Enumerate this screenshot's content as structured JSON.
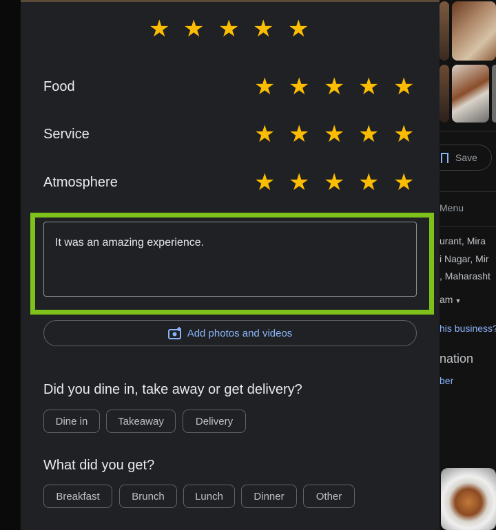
{
  "overall_rating": 5,
  "categories": [
    {
      "label": "Food",
      "rating": 5
    },
    {
      "label": "Service",
      "rating": 5
    },
    {
      "label": "Atmosphere",
      "rating": 5
    }
  ],
  "review": {
    "text": "It was an amazing experience."
  },
  "add_photos_label": "Add photos and videos",
  "dining": {
    "question": "Did you dine in, take away or get delivery?",
    "options": [
      "Dine in",
      "Takeaway",
      "Delivery"
    ]
  },
  "meal": {
    "question": "What did you get?",
    "options": [
      "Breakfast",
      "Brunch",
      "Lunch",
      "Dinner",
      "Other"
    ]
  },
  "background": {
    "save_label": "Save",
    "menu_label": "Menu",
    "address_1": "urant, Mira",
    "address_2": "i Nagar, Mir",
    "address_3": ", Maharasht",
    "hours": "am",
    "claim": "his business?",
    "section": "nation",
    "phone_link": "ber"
  },
  "colors": {
    "star": "#fbbc04",
    "highlight": "#7ec11a",
    "link": "#8ab4f8"
  }
}
